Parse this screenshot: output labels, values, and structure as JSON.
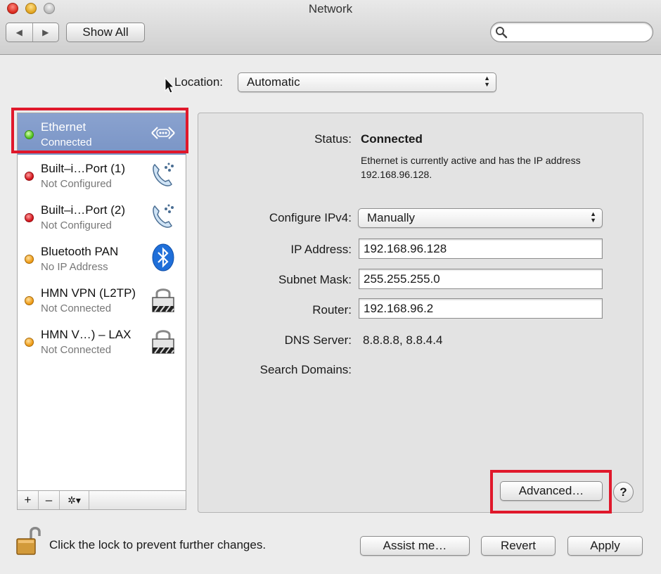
{
  "window": {
    "title": "Network"
  },
  "toolbar": {
    "back_label": "◀",
    "forward_label": "▶",
    "show_all_label": "Show All",
    "search_placeholder": ""
  },
  "location": {
    "label": "Location:",
    "value": "Automatic"
  },
  "services": [
    {
      "name": "Ethernet",
      "status": "Connected",
      "dot": "green",
      "icon": "ethernet-icon",
      "selected": true
    },
    {
      "name": "Built–i…Port (1)",
      "status": "Not Configured",
      "dot": "red",
      "icon": "phone-modem-icon",
      "selected": false
    },
    {
      "name": "Built–i…Port (2)",
      "status": "Not Configured",
      "dot": "red",
      "icon": "phone-modem-icon",
      "selected": false
    },
    {
      "name": "Bluetooth PAN",
      "status": "No IP Address",
      "dot": "orange",
      "icon": "bluetooth-icon",
      "selected": false
    },
    {
      "name": "HMN VPN (L2TP)",
      "status": "Not Connected",
      "dot": "orange",
      "icon": "vpn-lock-icon",
      "selected": false
    },
    {
      "name": "HMN V…) – LAX",
      "status": "Not Connected",
      "dot": "orange",
      "icon": "vpn-lock-icon",
      "selected": false
    }
  ],
  "sidebar_controls": {
    "add": "+",
    "remove": "–",
    "gear": "✲▾"
  },
  "details": {
    "status_label": "Status:",
    "status_value": "Connected",
    "status_description": "Ethernet is currently active and has the IP address 192.168.96.128.",
    "configure_label": "Configure IPv4:",
    "configure_value": "Manually",
    "ip_label": "IP Address:",
    "ip_value": "192.168.96.128",
    "subnet_label": "Subnet Mask:",
    "subnet_value": "255.255.255.0",
    "router_label": "Router:",
    "router_value": "192.168.96.2",
    "dns_label": "DNS Server:",
    "dns_value": "8.8.8.8, 8.8.4.4",
    "search_domains_label": "Search Domains:",
    "advanced_label": "Advanced…",
    "help_label": "?"
  },
  "footer": {
    "lock_text": "Click the lock to prevent further changes.",
    "assist_label": "Assist me…",
    "revert_label": "Revert",
    "apply_label": "Apply"
  },
  "colors": {
    "highlight": "#e0182b",
    "selection": "#7f99c9"
  }
}
